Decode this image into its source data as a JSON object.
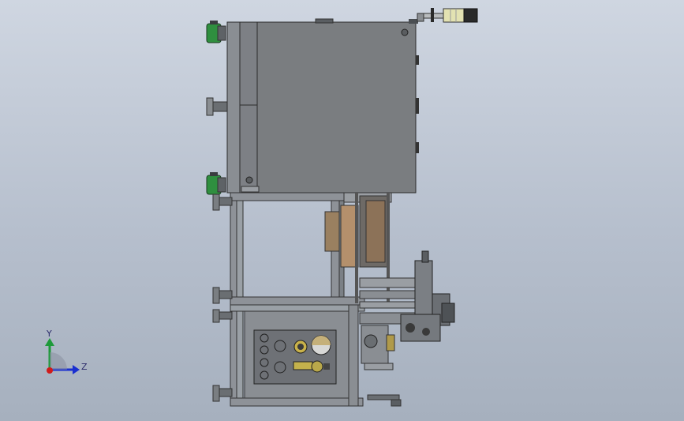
{
  "triad": {
    "y_label": "Y",
    "z_label": "Z"
  },
  "colors": {
    "background_top": "#cfd6e1",
    "background_bottom": "#a6b0be",
    "cabinet": "#7a7d80",
    "frame": "#8e9298",
    "panel": "#6e7176",
    "foot_green": "#2f8f3f",
    "axis_y": "#1e9a3a",
    "axis_z": "#1a2fd0",
    "origin": "#d01b1b"
  }
}
